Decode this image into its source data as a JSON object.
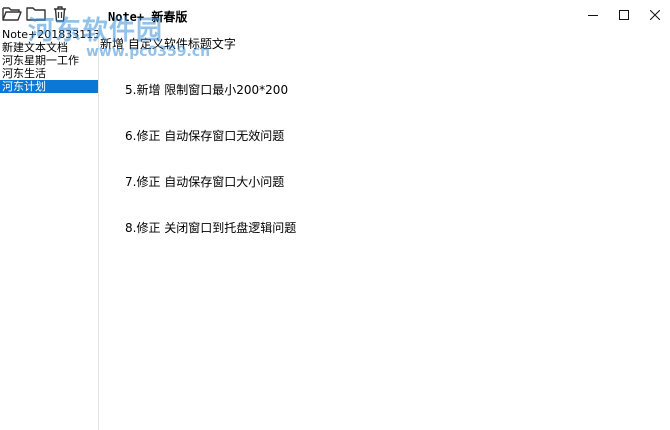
{
  "window": {
    "title": "Note+ 新春版",
    "controls": {
      "minimize": "—",
      "maximize": "☐",
      "close": "✕"
    }
  },
  "toolbar": {
    "buttons": [
      {
        "icon": "open-folder-icon"
      },
      {
        "icon": "folder-icon"
      },
      {
        "icon": "trash-icon"
      }
    ]
  },
  "watermark": {
    "text": "河东软件园",
    "url": "www.pc0359.cn"
  },
  "notes": [
    {
      "label": "Note+2018331132"
    },
    {
      "label": "新建文本文档"
    },
    {
      "label": "河东星期一工作"
    },
    {
      "label": "河东生活"
    },
    {
      "label": "河东计划",
      "selected": true
    }
  ],
  "content": {
    "lines": [
      "新增 自定义软件标题文字",
      "5.新增 限制窗口最小200*200",
      "6.修正 自动保存窗口无效问题",
      "7.修正 自动保存窗口大小问题",
      "8.修正 关闭窗口到托盘逻辑问题"
    ]
  },
  "colors": {
    "selection": "#0a78d7",
    "watermark": "#3a8fd8"
  }
}
